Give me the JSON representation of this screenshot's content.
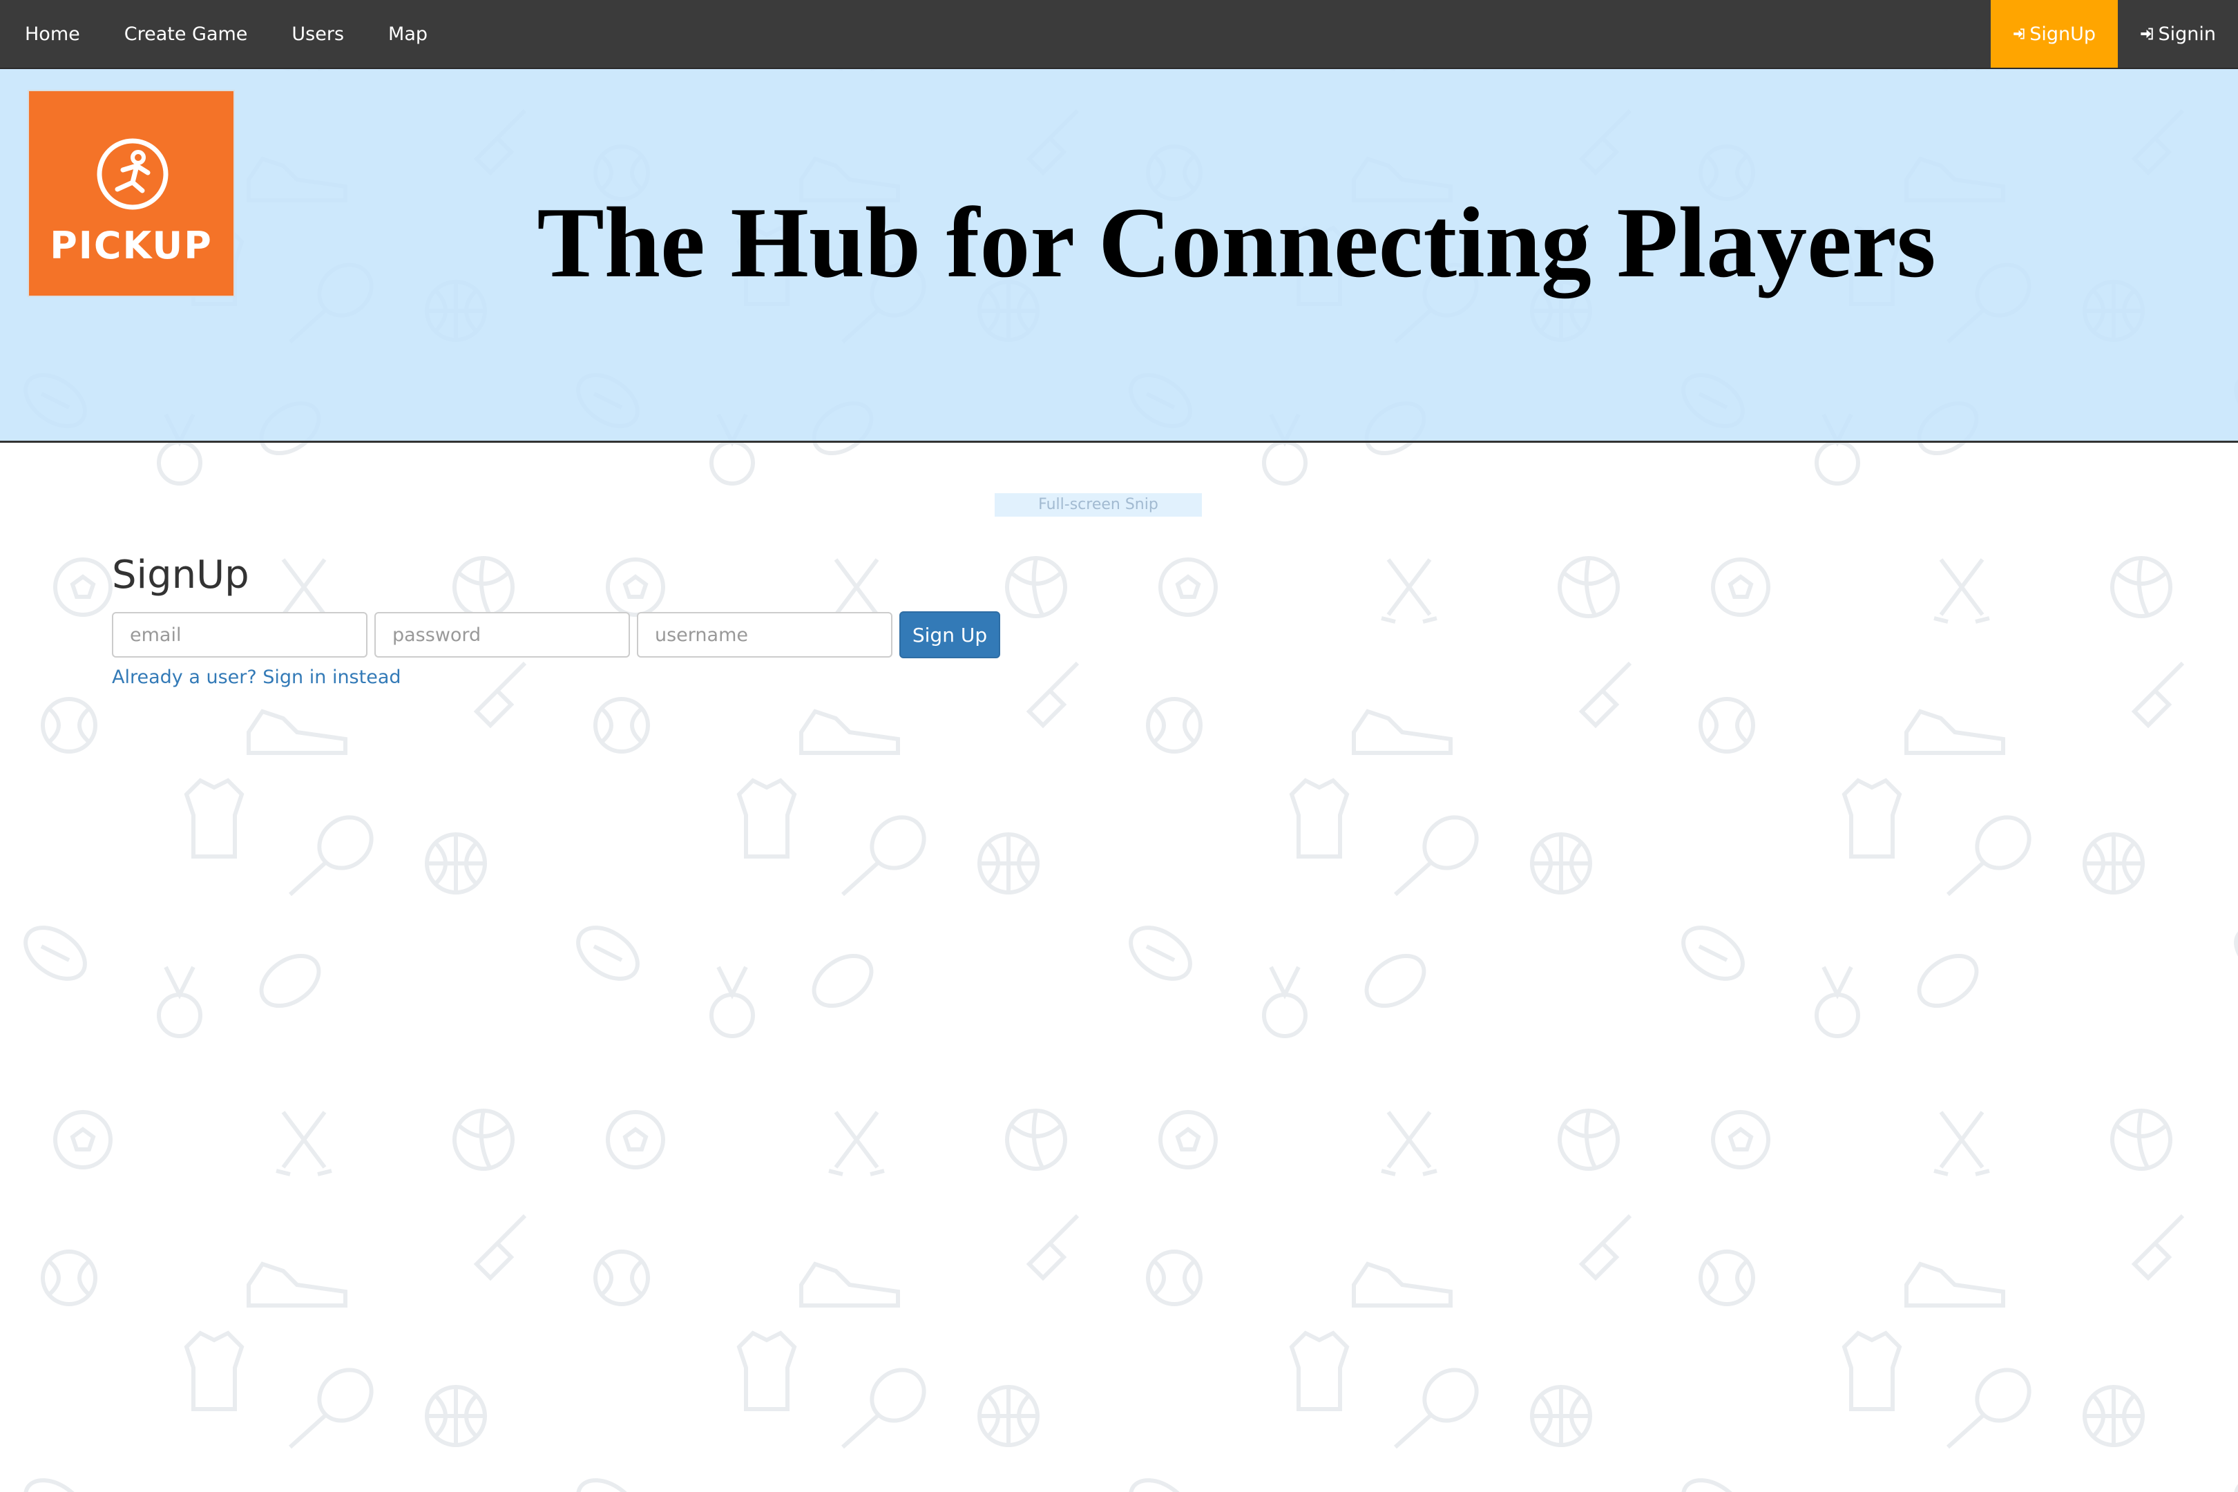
{
  "nav": {
    "links": [
      "Home",
      "Create Game",
      "Users",
      "Map"
    ],
    "signup_label": "SignUp",
    "signin_label": "Signin",
    "signup_color": "#ffa500",
    "bar_color": "#3b3b3b",
    "signin_icon": "sign-in-icon"
  },
  "hero": {
    "logo_text": "PICKUP",
    "logo_icon": "running-person-icon",
    "logo_color": "#f47328",
    "title": "The Hub for Connecting Players",
    "background": "#c4e4fc"
  },
  "snip": {
    "label": "Full-screen Snip"
  },
  "signup": {
    "heading": "SignUp",
    "email_placeholder": "email",
    "password_placeholder": "password",
    "username_placeholder": "username",
    "button_label": "Sign Up",
    "signin_link": "Already a user? Sign in instead",
    "button_color": "#337ab7"
  }
}
